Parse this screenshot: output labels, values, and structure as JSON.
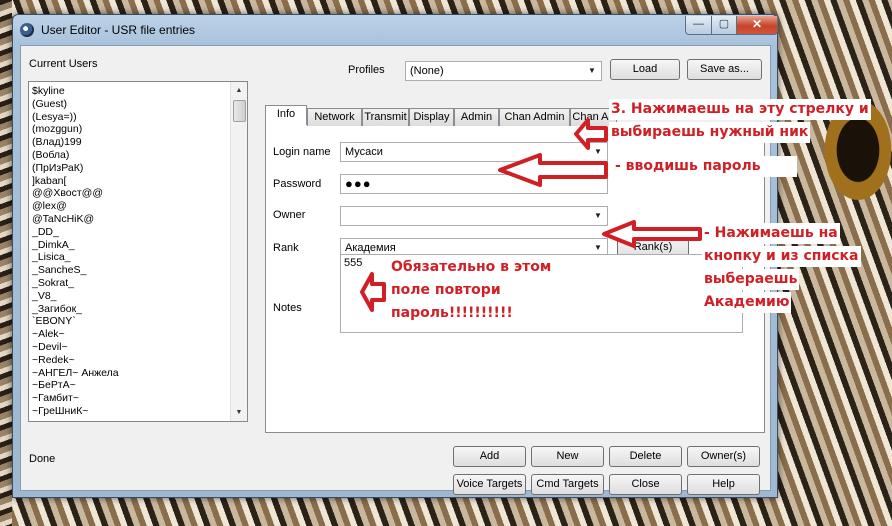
{
  "window": {
    "title": "User Editor - USR file entries",
    "controls": {
      "minimize": "—",
      "maximize": "▢",
      "close": "✕"
    }
  },
  "users": {
    "label": "Current Users",
    "items": [
      "$kyline",
      "(Guest)",
      "(Lesya=))",
      "(mozggun)",
      "(Влад)199",
      "(Вобла)",
      "(ПрИзРаК)",
      "]kaban[",
      "@@Хвост@@",
      "@lex@",
      "@TaNcHiK@",
      "_DD_",
      "_DimkA_",
      "_Lisica_",
      "_SancheS_",
      "_Sokrat_",
      "_V8_",
      "_Загибок_",
      "`EBONY`",
      "~Alek~",
      "~Devil~",
      "~Redek~",
      "~АНГЕЛ~ Анжела",
      "~БеРтА~",
      "~Гамбит~",
      "~ГреШниК~"
    ]
  },
  "profiles": {
    "label": "Profiles",
    "value": "(None)",
    "load_label": "Load",
    "save_as_label": "Save as..."
  },
  "tabs": [
    "Info",
    "Network",
    "Transmit",
    "Display",
    "Admin",
    "Chan Admin",
    "Chan Au"
  ],
  "form": {
    "login_label": "Login name",
    "login_value": "Мусаси",
    "password_label": "Password",
    "password_value": "●●●",
    "owner_label": "Owner",
    "owner_value": "",
    "rank_label": "Rank",
    "rank_value": "Академия",
    "rank_button": "Rank(s)",
    "notes_label": "Notes",
    "notes_value": "555"
  },
  "status": "Done",
  "buttons": {
    "add": "Add",
    "new": "New",
    "delete": "Delete",
    "owners": "Owner(s)",
    "voice_targets": "Voice Targets",
    "cmd_targets": "Cmd Targets",
    "close": "Close",
    "help": "Help"
  },
  "annotations": {
    "step3_line1": "3. Нажимаешь на эту стрелку и",
    "step3_line2": "выбираешь нужный ник",
    "password_hint": "- вводишь пароль",
    "rank_line1": "- Нажимаешь на",
    "rank_line2": "кнопку и из списка",
    "rank_line3": "выбераешь",
    "rank_line4": "Академию",
    "notes_line1": "Обязательно в этом",
    "notes_line2": "поле повтори",
    "notes_line3": "пароль!!!!!!!!!!"
  },
  "colors": {
    "annotation": "#d11f26",
    "window_frame": "#a9c2dc",
    "close_button": "#c6442a"
  }
}
